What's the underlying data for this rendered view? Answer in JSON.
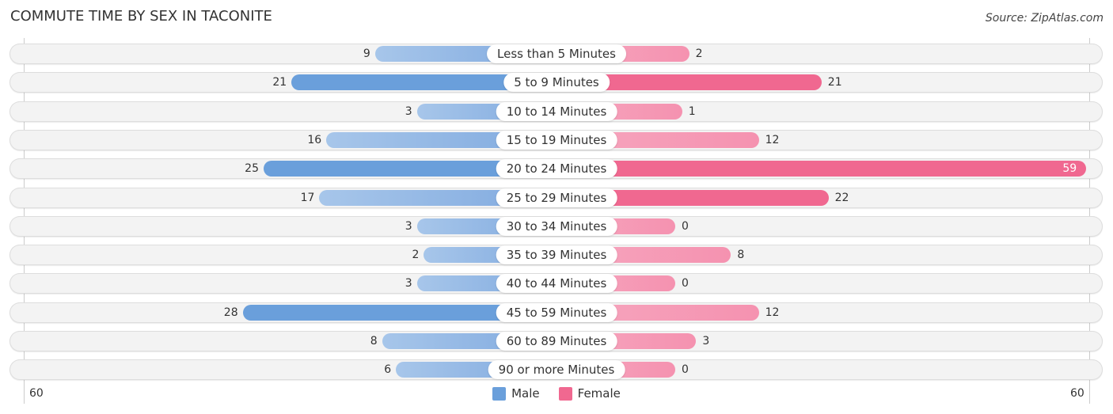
{
  "header": {
    "title": "COMMUTE TIME BY SEX IN TACONITE",
    "source": "Source: ZipAtlas.com"
  },
  "colors": {
    "male": "#6a9fdb",
    "female": "#f06890",
    "track": "#f3f3f3"
  },
  "legend": {
    "male_label": "Male",
    "female_label": "Female"
  },
  "axis": {
    "left_tick": "60",
    "right_tick": "60"
  },
  "chart_data": {
    "type": "bar",
    "orientation": "horizontal-diverging",
    "title": "COMMUTE TIME BY SEX IN TACONITE",
    "xlabel": "",
    "ylabel": "",
    "xlim": [
      -60,
      60
    ],
    "legend_position": "bottom-center",
    "grid": false,
    "categories": [
      "Less than 5 Minutes",
      "5 to 9 Minutes",
      "10 to 14 Minutes",
      "15 to 19 Minutes",
      "20 to 24 Minutes",
      "25 to 29 Minutes",
      "30 to 34 Minutes",
      "35 to 39 Minutes",
      "40 to 44 Minutes",
      "45 to 59 Minutes",
      "60 to 89 Minutes",
      "90 or more Minutes"
    ],
    "series": [
      {
        "name": "Male",
        "side": "left",
        "values": [
          9,
          21,
          3,
          16,
          25,
          17,
          3,
          2,
          3,
          28,
          8,
          6
        ]
      },
      {
        "name": "Female",
        "side": "right",
        "values": [
          2,
          21,
          1,
          12,
          59,
          22,
          0,
          8,
          0,
          12,
          3,
          0
        ]
      }
    ]
  }
}
